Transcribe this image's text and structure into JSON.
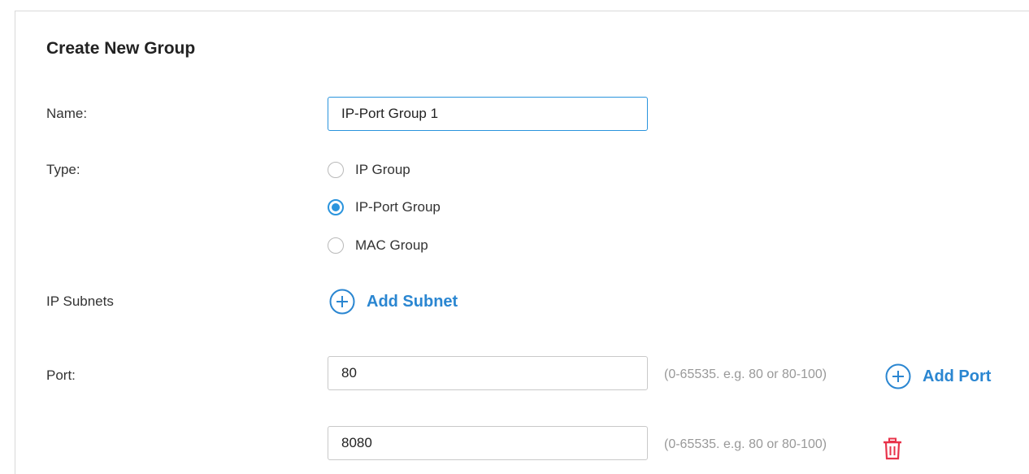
{
  "form": {
    "title": "Create New Group",
    "name": {
      "label": "Name:",
      "value": "IP-Port Group 1"
    },
    "type": {
      "label": "Type:",
      "options": [
        {
          "label": "IP Group",
          "selected": false
        },
        {
          "label": "IP-Port Group",
          "selected": true
        },
        {
          "label": "MAC Group",
          "selected": false
        }
      ]
    },
    "ip_subnets": {
      "label": "IP Subnets",
      "add_label": "Add Subnet"
    },
    "port": {
      "label": "Port:",
      "entries": [
        {
          "value": "80",
          "hint": "(0-65535. e.g. 80 or 80-100)"
        },
        {
          "value": "8080",
          "hint": "(0-65535. e.g. 80 or 80-100)"
        }
      ],
      "add_label": "Add Port"
    }
  },
  "colors": {
    "accent": "#2a94dd",
    "link": "#2a86d1",
    "delete": "#e8334a",
    "hint": "#999999"
  },
  "icons": {
    "add": "plus-circle-icon",
    "delete": "trash-icon"
  }
}
